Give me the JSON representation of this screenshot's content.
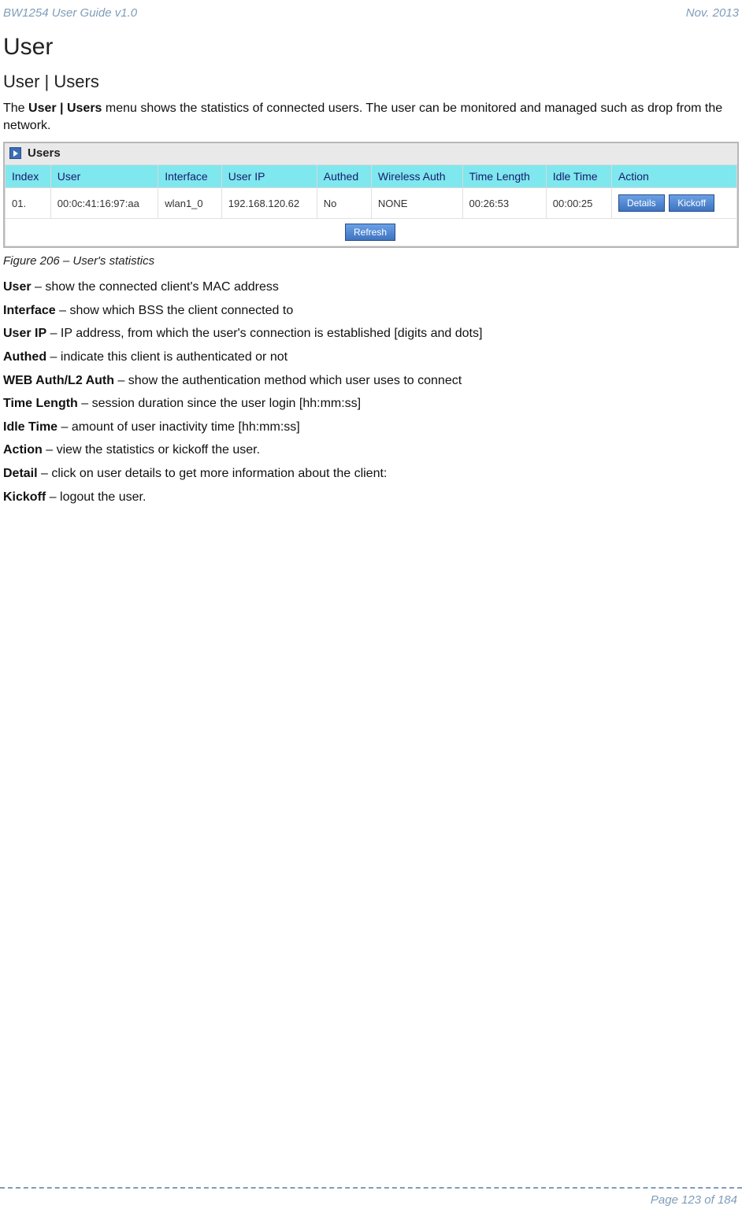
{
  "header": {
    "left": "BW1254 User Guide v1.0",
    "right": "Nov.  2013"
  },
  "headings": {
    "main": "User",
    "section": "User | Users"
  },
  "intro": {
    "prefix": "The ",
    "bold": "User | Users",
    "suffix": " menu shows the statistics of connected users. The user can be monitored and managed such as drop from the network."
  },
  "table": {
    "title": "Users",
    "columns": [
      "Index",
      "User",
      "Interface",
      "User IP",
      "Authed",
      "Wireless Auth",
      "Time Length",
      "Idle Time",
      "Action"
    ],
    "rows": [
      {
        "index": "01.",
        "user": "00:0c:41:16:97:aa",
        "interface": "wlan1_0",
        "user_ip": "192.168.120.62",
        "authed": "No",
        "wireless_auth": "NONE",
        "time_length": "00:26:53",
        "idle_time": "00:00:25",
        "details_label": "Details",
        "kickoff_label": "Kickoff"
      }
    ],
    "refresh_label": "Refresh"
  },
  "figure_caption": "Figure 206 – User's statistics",
  "definitions": [
    {
      "term": "User",
      "desc": " – show the connected client's MAC address"
    },
    {
      "term": "Interface",
      "desc": " – show which BSS the client connected to"
    },
    {
      "term": "User IP",
      "desc": " – IP address, from which the user's connection is established [digits and dots]"
    },
    {
      "term": "Authed",
      "desc": " – indicate this client is authenticated or not"
    },
    {
      "term": "WEB Auth/L2 Auth",
      "desc": " – show the authentication method which user uses to connect"
    },
    {
      "term": "Time Length",
      "desc": " – session duration since the user login [hh:mm:ss]"
    },
    {
      "term": "Idle Time",
      "desc": " – amount of user inactivity time [hh:mm:ss]"
    },
    {
      "term": "Action",
      "desc": " – view the statistics or kickoff the user."
    },
    {
      "term": "Detail",
      "desc": " – click on user details to get more information about the client:"
    },
    {
      "term": "Kickoff",
      "desc": " – logout the user."
    }
  ],
  "footer": "Page 123 of 184"
}
